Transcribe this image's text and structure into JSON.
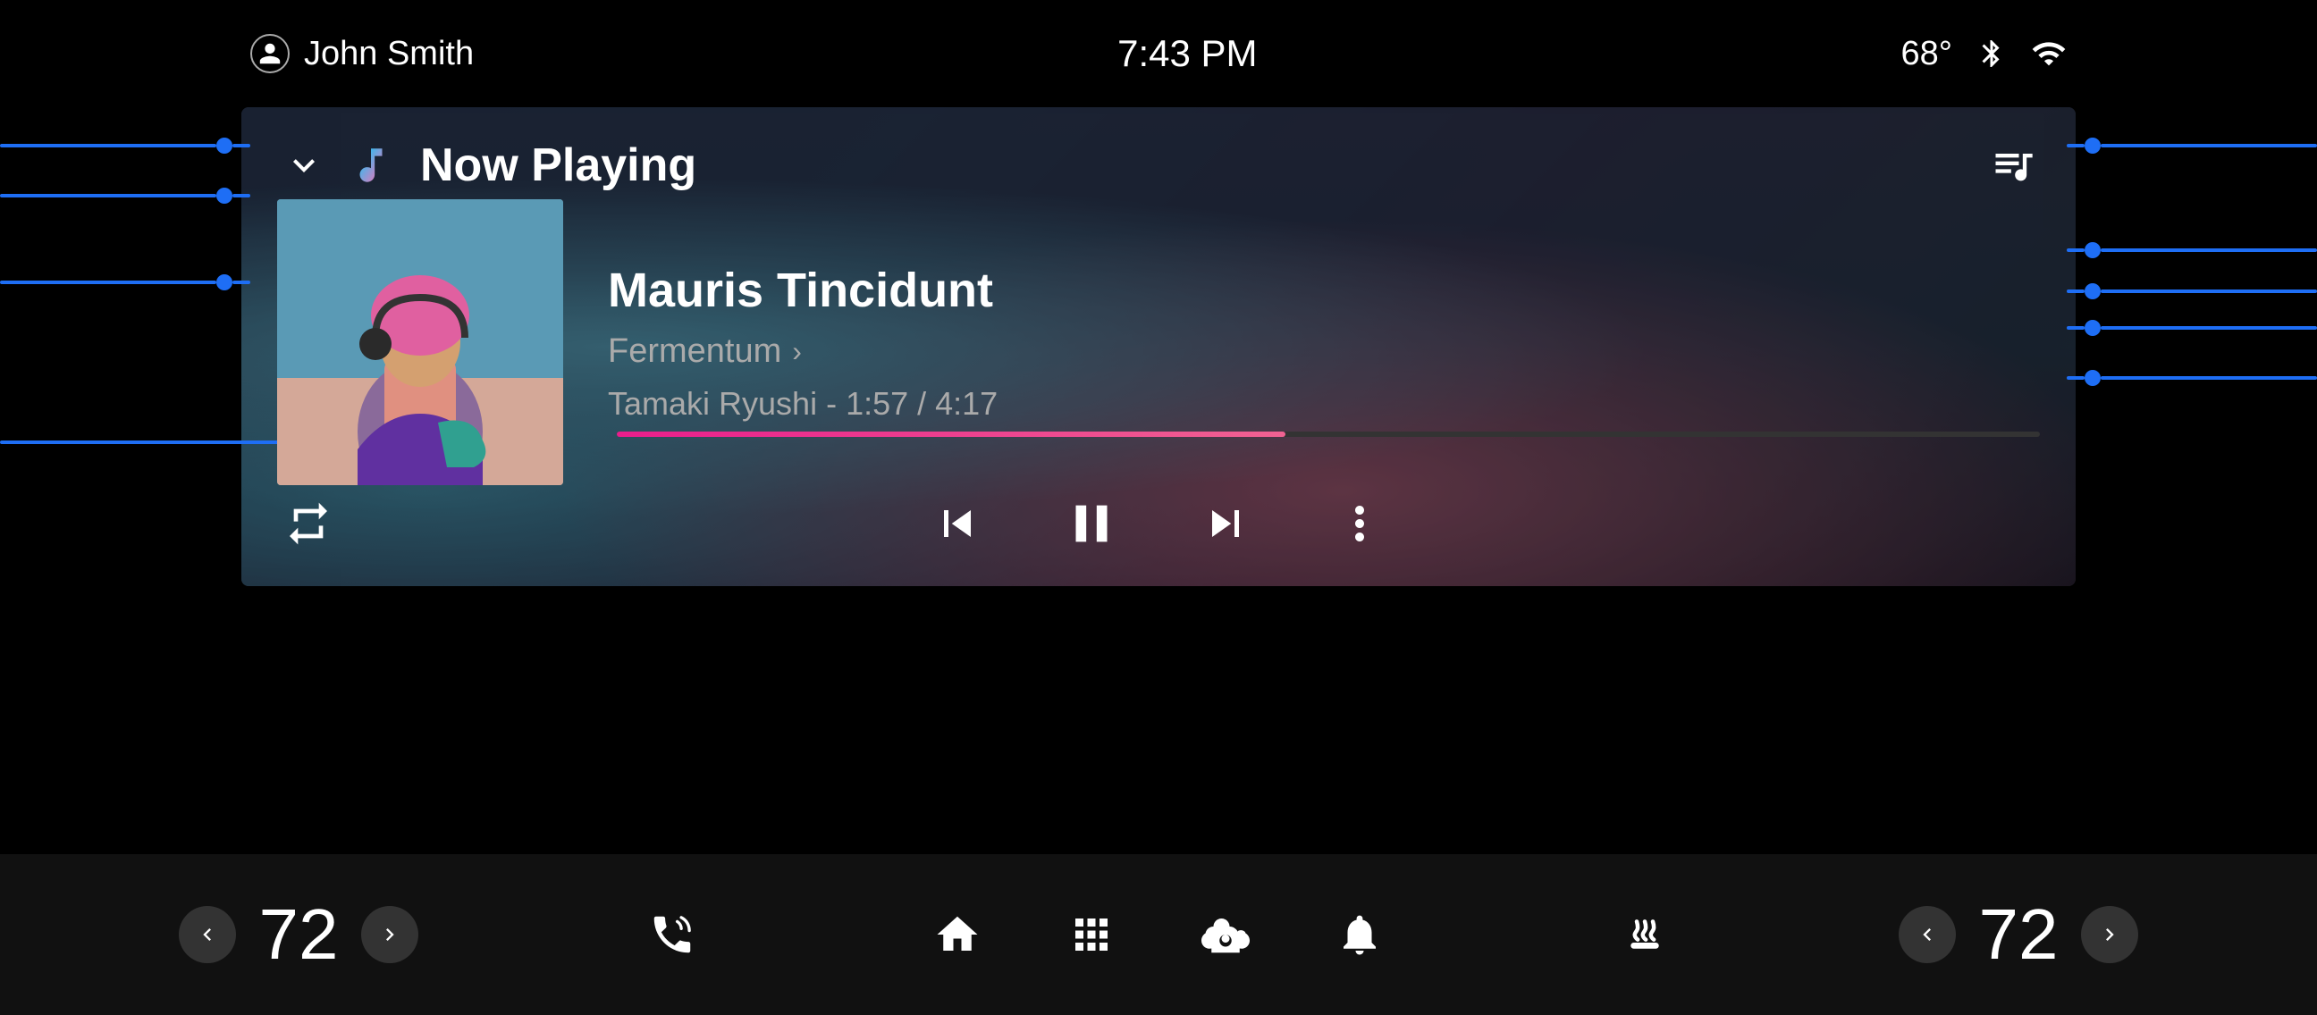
{
  "statusBar": {
    "username": "John Smith",
    "time": "7:43 PM",
    "temperature": "68°"
  },
  "player": {
    "headerTitle": "Now Playing",
    "track": {
      "name": "Mauris Tincidunt",
      "album": "Fermentum",
      "artistTime": "Tamaki Ryushi - 1:57 / 4:17",
      "progressPercent": 47
    },
    "controls": {
      "repeat": "⇄",
      "prev": "⏮",
      "pause": "⏸",
      "next": "⏭",
      "more": "⋮"
    }
  },
  "bottomBar": {
    "leftTemp": "72",
    "rightTemp": "72",
    "icons": [
      "phone",
      "home",
      "grid",
      "fan",
      "bell",
      "heat"
    ]
  }
}
